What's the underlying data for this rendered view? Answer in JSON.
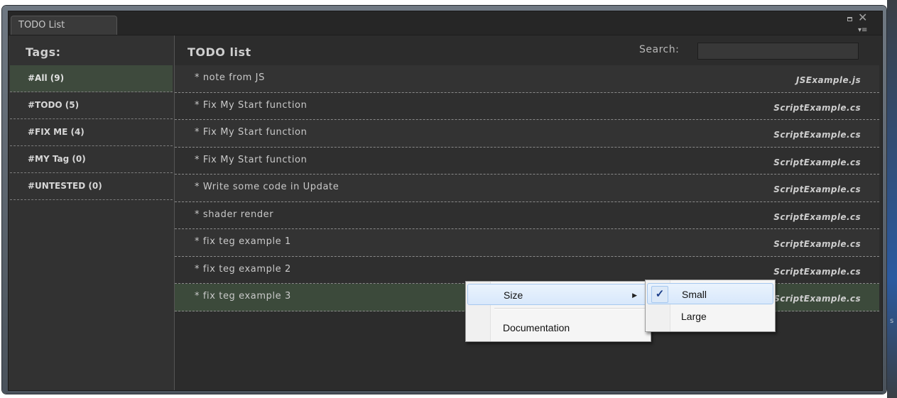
{
  "window": {
    "tab_label": "TODO List"
  },
  "tags": {
    "title": "Tags:",
    "items": [
      {
        "label": "#All (9)"
      },
      {
        "label": "#TODO (5)"
      },
      {
        "label": "#FIX ME (4)"
      },
      {
        "label": "#MY Tag (0)"
      },
      {
        "label": "#UNTESTED (0)"
      }
    ]
  },
  "todo": {
    "title": "TODO list",
    "search_label": "Search:",
    "search_value": "",
    "rows": [
      {
        "text": "* note from JS",
        "file": "JSExample.js"
      },
      {
        "text": "* Fix My Start function",
        "file": "ScriptExample.cs"
      },
      {
        "text": "* Fix My Start function",
        "file": "ScriptExample.cs"
      },
      {
        "text": "* Fix My Start function",
        "file": "ScriptExample.cs"
      },
      {
        "text": "* Write some code in Update",
        "file": "ScriptExample.cs"
      },
      {
        "text": "* shader render",
        "file": "ScriptExample.cs"
      },
      {
        "text": "* fix teg example 1",
        "file": "ScriptExample.cs"
      },
      {
        "text": "* fix teg example 2",
        "file": "ScriptExample.cs"
      },
      {
        "text": "* fix teg example 3",
        "file": "ScriptExample.cs"
      }
    ]
  },
  "context_menu": {
    "size_label": "Size",
    "documentation_label": "Documentation",
    "submenu": {
      "small_label": "Small",
      "large_label": "Large",
      "check_mark": "✓"
    }
  },
  "edge": {
    "letter": "s"
  },
  "colors": {
    "selected_row": "#3c4a3b",
    "menu_highlight": "#d8e8fb"
  },
  "icons": [
    "maximize-icon",
    "close-icon",
    "options-menu-icon",
    "submenu-arrow-icon",
    "check-icon"
  ]
}
